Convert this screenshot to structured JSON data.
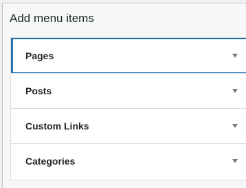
{
  "panel": {
    "title": "Add menu items"
  },
  "sections": [
    {
      "label": "Pages",
      "icon": "chevron-down-icon",
      "expanded": false,
      "focused": true
    },
    {
      "label": "Posts",
      "icon": "chevron-down-icon",
      "expanded": false,
      "focused": false
    },
    {
      "label": "Custom Links",
      "icon": "chevron-down-icon",
      "expanded": false,
      "focused": false
    },
    {
      "label": "Categories",
      "icon": "chevron-down-icon",
      "expanded": false,
      "focused": false
    }
  ],
  "colors": {
    "focus": "#2271b1",
    "border": "#dcdcde",
    "arrow": "#787c82",
    "text": "#1d2327",
    "background": "#f1f1f1"
  }
}
